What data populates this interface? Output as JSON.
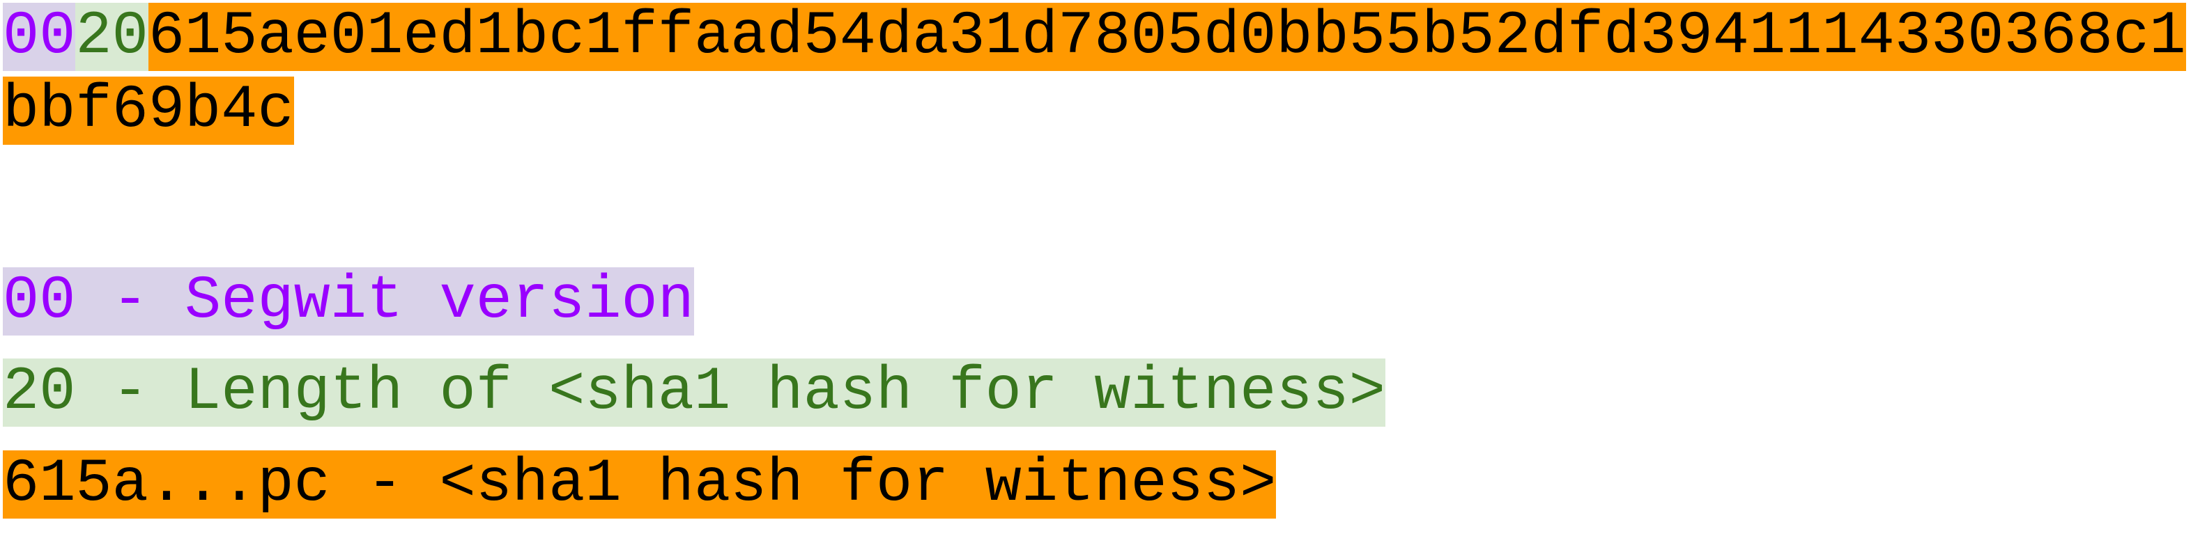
{
  "script_hex": {
    "version": "00",
    "length": "20",
    "hash": "615ae01ed1bc1ffaad54da31d7805d0bb55b52dfd3941114330368c1bbf69b4c"
  },
  "legend": [
    {
      "text": "00 - Segwit version"
    },
    {
      "text": "20 - Length of <sha1 hash for witness>"
    },
    {
      "text": "615a...pc - <sha1 hash for witness>"
    }
  ],
  "colors": {
    "version_text": "#9900ff",
    "version_bg": "#d9d2e9",
    "length_text": "#38761d",
    "length_bg": "#d9ead3",
    "hash_bg": "#ff9900"
  }
}
